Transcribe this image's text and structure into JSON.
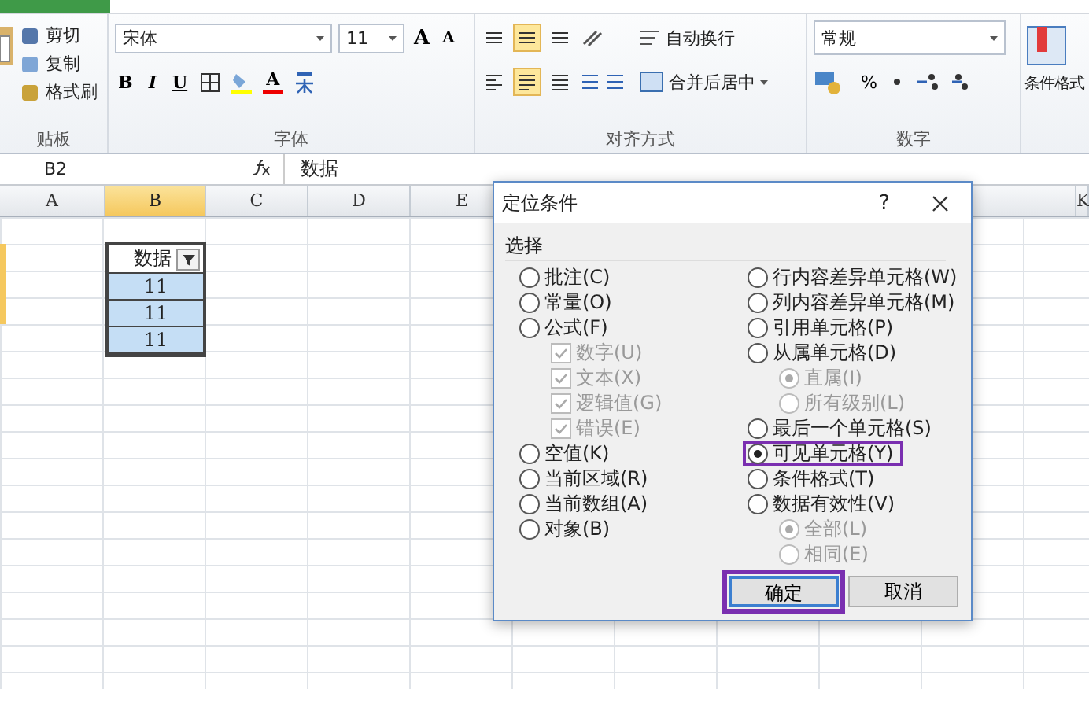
{
  "ribbon": {
    "clipboard": {
      "label": "贴板",
      "items": [
        "剪切",
        "复制",
        "格式刷"
      ]
    },
    "font": {
      "label": "字体",
      "font_name": "宋体",
      "font_size": "11",
      "grow": "A",
      "shrink": "A",
      "styles": [
        "B",
        "I",
        "U"
      ],
      "color_letter": "A"
    },
    "alignment": {
      "label": "对齐方式",
      "wrap": "自动换行",
      "merge": "合并后居中"
    },
    "number": {
      "label": "数字",
      "format": "常规",
      "percent": "%"
    },
    "styles": {
      "conditional_format": "条件格式"
    }
  },
  "formula_bar": {
    "name_box": "B2",
    "value": "数据"
  },
  "sheet": {
    "columns": [
      {
        "label": "A",
        "selected": false
      },
      {
        "label": "B",
        "selected": true
      },
      {
        "label": "C",
        "selected": false
      },
      {
        "label": "D",
        "selected": false
      },
      {
        "label": "E",
        "selected": false
      },
      {
        "label": "K",
        "selected": false
      }
    ],
    "table": {
      "header": "数据",
      "values": [
        "11",
        "11",
        "11"
      ]
    }
  },
  "dialog": {
    "title": "定位条件",
    "help": "?",
    "group": "选择",
    "left": [
      {
        "kind": "radio",
        "label": "批注(C)",
        "selected": false,
        "disabled": false
      },
      {
        "kind": "radio",
        "label": "常量(O)",
        "selected": false,
        "disabled": false
      },
      {
        "kind": "radio",
        "label": "公式(F)",
        "selected": false,
        "disabled": false,
        "children": [
          {
            "kind": "check",
            "label": "数字(U)",
            "checked": true,
            "disabled": true
          },
          {
            "kind": "check",
            "label": "文本(X)",
            "checked": true,
            "disabled": true
          },
          {
            "kind": "check",
            "label": "逻辑值(G)",
            "checked": true,
            "disabled": true
          },
          {
            "kind": "check",
            "label": "错误(E)",
            "checked": true,
            "disabled": true
          }
        ]
      },
      {
        "kind": "radio",
        "label": "空值(K)",
        "selected": false,
        "disabled": false
      },
      {
        "kind": "radio",
        "label": "当前区域(R)",
        "selected": false,
        "disabled": false
      },
      {
        "kind": "radio",
        "label": "当前数组(A)",
        "selected": false,
        "disabled": false
      },
      {
        "kind": "radio",
        "label": "对象(B)",
        "selected": false,
        "disabled": false
      }
    ],
    "right": [
      {
        "kind": "radio",
        "label": "行内容差异单元格(W)",
        "selected": false,
        "disabled": false
      },
      {
        "kind": "radio",
        "label": "列内容差异单元格(M)",
        "selected": false,
        "disabled": false
      },
      {
        "kind": "radio",
        "label": "引用单元格(P)",
        "selected": false,
        "disabled": false
      },
      {
        "kind": "radio",
        "label": "从属单元格(D)",
        "selected": false,
        "disabled": false,
        "children": [
          {
            "kind": "radio",
            "label": "直属(I)",
            "selected": true,
            "disabled": true
          },
          {
            "kind": "radio",
            "label": "所有级别(L)",
            "selected": false,
            "disabled": true
          }
        ]
      },
      {
        "kind": "radio",
        "label": "最后一个单元格(S)",
        "selected": false,
        "disabled": false
      },
      {
        "kind": "radio",
        "label": "可见单元格(Y)",
        "selected": true,
        "disabled": false,
        "highlighted": true
      },
      {
        "kind": "radio",
        "label": "条件格式(T)",
        "selected": false,
        "disabled": false
      },
      {
        "kind": "radio",
        "label": "数据有效性(V)",
        "selected": false,
        "disabled": false,
        "children": [
          {
            "kind": "radio",
            "label": "全部(L)",
            "selected": true,
            "disabled": true
          },
          {
            "kind": "radio",
            "label": "相同(E)",
            "selected": false,
            "disabled": true
          }
        ]
      }
    ],
    "buttons": [
      {
        "label": "确定",
        "default": true,
        "highlighted": true
      },
      {
        "label": "取消",
        "default": false,
        "highlighted": false
      }
    ]
  }
}
